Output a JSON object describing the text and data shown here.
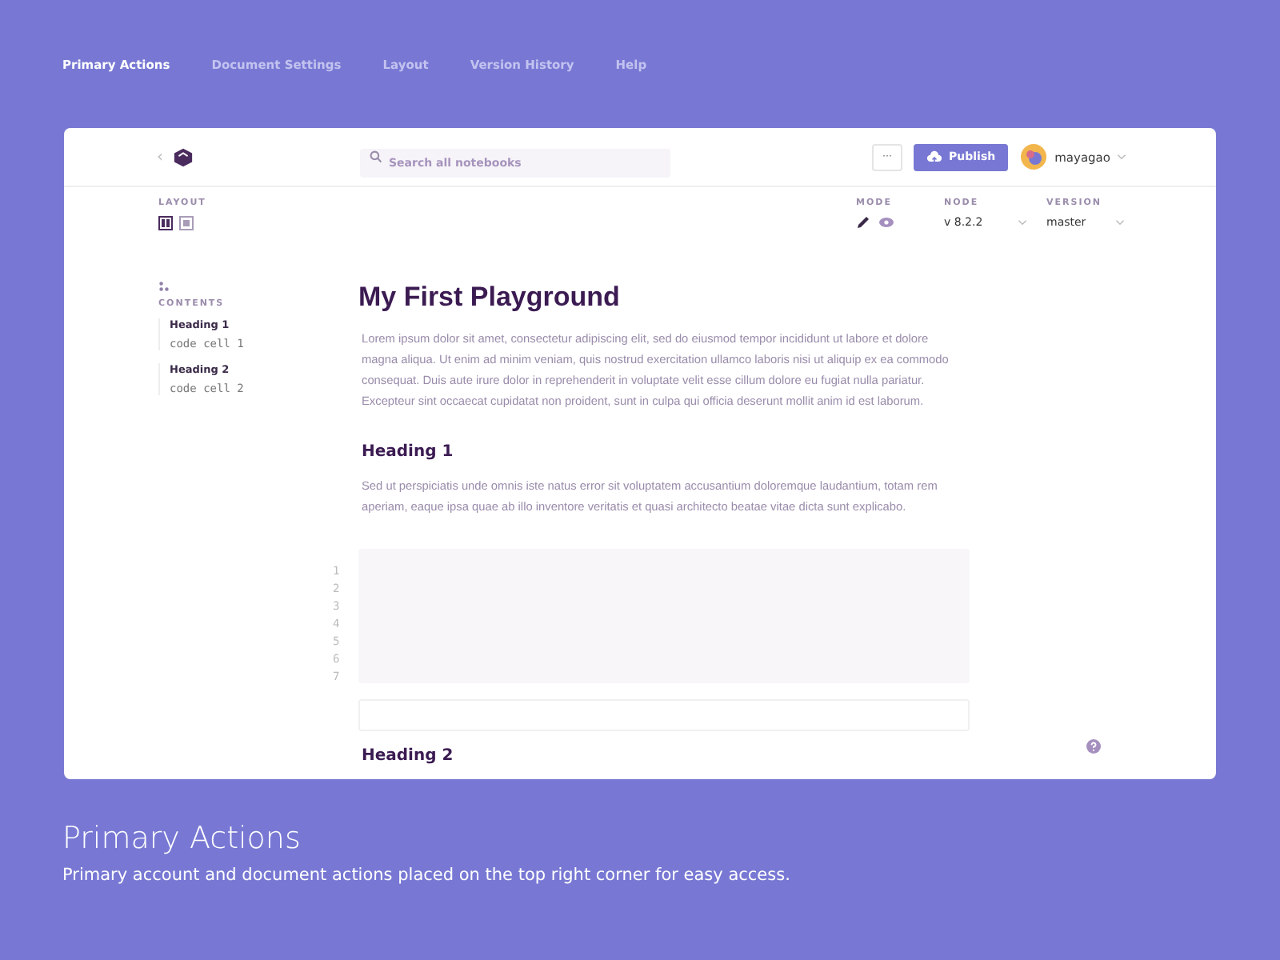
{
  "nav": [
    {
      "label": "Primary Actions",
      "selected": true
    },
    {
      "label": "Document Settings",
      "selected": false
    },
    {
      "label": "Layout",
      "selected": false
    },
    {
      "label": "Version History",
      "selected": false
    },
    {
      "label": "Help",
      "selected": false
    }
  ],
  "header": {
    "back": "‹",
    "search": {
      "placeholder": "Search all notebooks"
    },
    "more": "···",
    "publish": "Publish",
    "user": "mayagao"
  },
  "layout": {
    "label": "LAYOUT",
    "options": [
      {
        "kind": "split",
        "selected": true
      },
      {
        "kind": "single",
        "selected": false
      }
    ]
  },
  "mode": {
    "label": "MODE",
    "options": [
      {
        "kind": "edit",
        "selected": true
      },
      {
        "kind": "view",
        "selected": false
      }
    ]
  },
  "node": {
    "label": "NODE",
    "value": "v 8.2.2"
  },
  "version": {
    "label": "VERSION",
    "value": "master"
  },
  "contents": {
    "label": "CONTENTS",
    "sections": [
      {
        "heading": "Heading 1",
        "cells": [
          "code cell 1"
        ]
      },
      {
        "heading": "Heading 2",
        "cells": [
          "code cell 2"
        ]
      }
    ]
  },
  "document": {
    "title": "My First Playground",
    "intro": "Lorem ipsum dolor sit amet, consectetur adipiscing elit, sed do eiusmod tempor incididunt ut labore et dolore magna aliqua. Ut enim ad minim veniam, quis nostrud exercitation ullamco laboris nisi ut aliquip ex ea commodo consequat. Duis aute irure dolor in reprehenderit in voluptate velit esse cillum dolore eu fugiat nulla pariatur. Excepteur sint occaecat cupidatat non proident, sunt in culpa qui officia deserunt mollit anim id est laborum.",
    "heading_1": "Heading 1",
    "paragraph_1": "Sed ut perspiciatis unde omnis iste natus error sit voluptatem accusantium doloremque laudantium, totam rem aperiam, eaque ipsa quae ab illo inventore veritatis et quasi architecto beatae vitae dicta sunt explicabo.",
    "line_numbers": [
      "1",
      "2",
      "3",
      "4",
      "5",
      "6",
      "7"
    ],
    "heading_2": "Heading 2"
  },
  "caption": {
    "title": "Primary Actions",
    "text": "Primary account and document actions placed on the top right corner for easy access."
  }
}
